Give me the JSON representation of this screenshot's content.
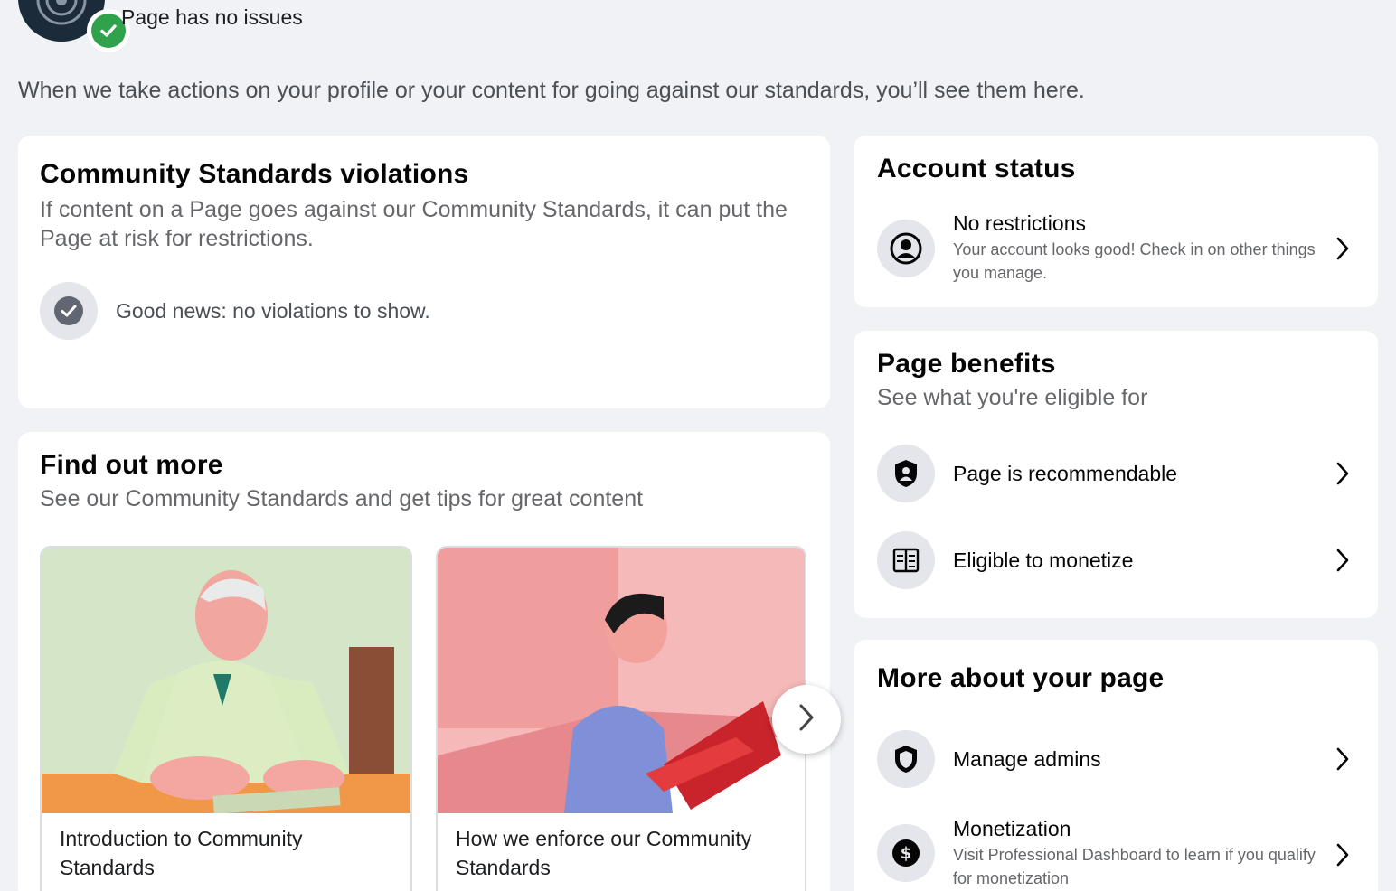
{
  "header": {
    "status": "Page has no issues",
    "intro": "When we take actions on your profile or your content for going against our standards, you’ll see them here."
  },
  "violations": {
    "title": "Community Standards violations",
    "subtitle": "If content on a Page goes against our Community Standards, it can put the Page at risk for restrictions.",
    "good_news": "Good news: no violations to show."
  },
  "find_out_more": {
    "title": "Find out more",
    "subtitle": "See our Community Standards and get tips for great content",
    "tiles": [
      {
        "caption": "Introduction to Community Standards"
      },
      {
        "caption": "How we enforce our Community Standards"
      }
    ]
  },
  "account_status": {
    "title": "Account status",
    "item": {
      "title": "No restrictions",
      "desc": "Your account looks good! Check in on other things you manage."
    }
  },
  "page_benefits": {
    "title": "Page benefits",
    "subtitle": "See what you're eligible for",
    "items": [
      {
        "title": "Page is recommendable"
      },
      {
        "title": "Eligible to monetize"
      }
    ]
  },
  "more_about": {
    "title": "More about your page",
    "items": [
      {
        "title": "Manage admins"
      },
      {
        "title": "Monetization",
        "desc": "Visit Professional Dashboard to learn if you qualify for monetization"
      }
    ]
  },
  "colors": {
    "background": "#f0f2f5",
    "card": "#ffffff",
    "success_green": "#31a24c",
    "icon_bg": "#e4e6eb",
    "secondary_text": "#65676b"
  },
  "icons": {
    "profile_check": "check-icon",
    "violations_check": "check-circle-icon",
    "account": "user-circle-icon",
    "recommendable": "shield-user-icon",
    "monetize": "ledger-icon",
    "admins": "shield-icon",
    "monetization": "dollar-icon",
    "next": "chevron-right-icon"
  }
}
